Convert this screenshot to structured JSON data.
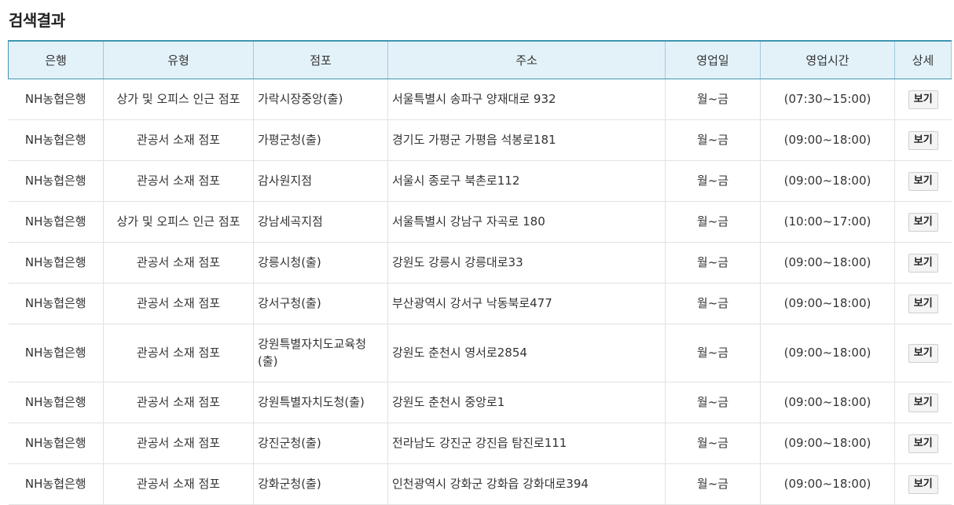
{
  "page": {
    "title": "검색결과"
  },
  "table": {
    "headers": [
      "은행",
      "유형",
      "점포",
      "주소",
      "영업일",
      "영업시간",
      "상세"
    ],
    "detail_label": "보기",
    "rows": [
      {
        "bank": "NH농협은행",
        "type": "상가 및 오피스 인근 점포",
        "branch": "가락시장중앙(출)",
        "address": "서울특별시 송파구 양재대로 932",
        "days": "월~금",
        "hours": "(07:30~15:00)"
      },
      {
        "bank": "NH농협은행",
        "type": "관공서 소재 점포",
        "branch": "가평군청(출)",
        "address": "경기도 가평군 가평읍 석봉로181",
        "days": "월~금",
        "hours": "(09:00~18:00)"
      },
      {
        "bank": "NH농협은행",
        "type": "관공서 소재 점포",
        "branch": "감사원지점",
        "address": "서울시 종로구 북촌로112",
        "days": "월~금",
        "hours": "(09:00~18:00)"
      },
      {
        "bank": "NH농협은행",
        "type": "상가 및 오피스 인근 점포",
        "branch": "강남세곡지점",
        "address": "서울특별시 강남구 자곡로 180",
        "days": "월~금",
        "hours": "(10:00~17:00)"
      },
      {
        "bank": "NH농협은행",
        "type": "관공서 소재 점포",
        "branch": "강릉시청(출)",
        "address": "강원도 강릉시 강릉대로33",
        "days": "월~금",
        "hours": "(09:00~18:00)"
      },
      {
        "bank": "NH농협은행",
        "type": "관공서 소재 점포",
        "branch": "강서구청(출)",
        "address": "부산광역시 강서구 낙동북로477",
        "days": "월~금",
        "hours": "(09:00~18:00)"
      },
      {
        "bank": "NH농협은행",
        "type": "관공서 소재 점포",
        "branch": "강원특별자치도교육청(출)",
        "address": "강원도 춘천시 영서로2854",
        "days": "월~금",
        "hours": "(09:00~18:00)"
      },
      {
        "bank": "NH농협은행",
        "type": "관공서 소재 점포",
        "branch": "강원특별자치도청(출)",
        "address": "강원도 춘천시 중앙로1",
        "days": "월~금",
        "hours": "(09:00~18:00)"
      },
      {
        "bank": "NH농협은행",
        "type": "관공서 소재 점포",
        "branch": "강진군청(출)",
        "address": "전라남도 강진군 강진읍 탐진로111",
        "days": "월~금",
        "hours": "(09:00~18:00)"
      },
      {
        "bank": "NH농협은행",
        "type": "관공서 소재 점포",
        "branch": "강화군청(출)",
        "address": "인천광역시 강화군 강화읍 강화대로394",
        "days": "월~금",
        "hours": "(09:00~18:00)"
      }
    ]
  }
}
